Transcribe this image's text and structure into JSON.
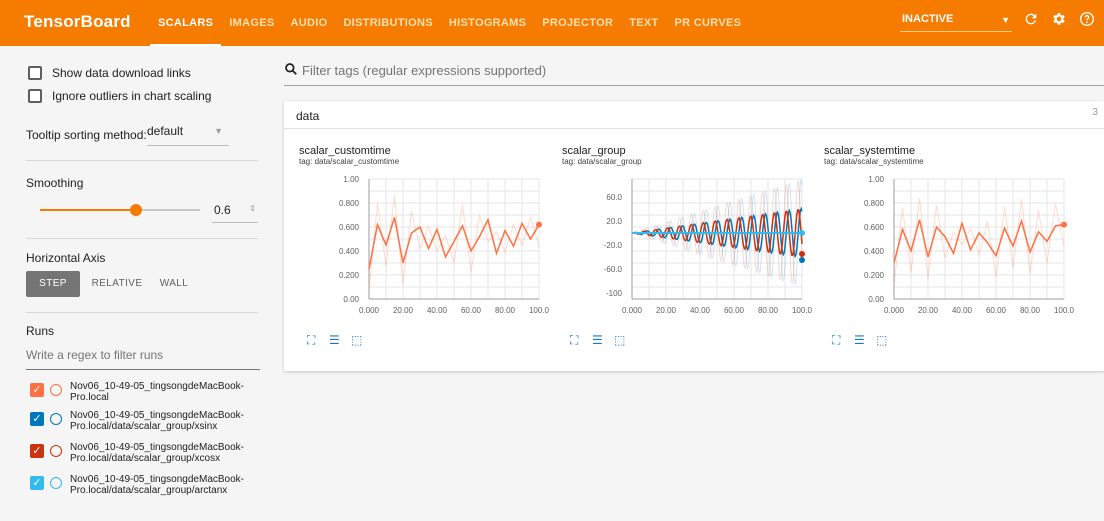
{
  "header": {
    "brand": "TensorBoard",
    "tabs": [
      {
        "label": "SCALARS",
        "active": true
      },
      {
        "label": "IMAGES",
        "active": false
      },
      {
        "label": "AUDIO",
        "active": false
      },
      {
        "label": "DISTRIBUTIONS",
        "active": false
      },
      {
        "label": "HISTOGRAMS",
        "active": false
      },
      {
        "label": "PROJECTOR",
        "active": false
      },
      {
        "label": "TEXT",
        "active": false
      },
      {
        "label": "PR CURVES",
        "active": false
      }
    ],
    "inactive_select": "INACTIVE",
    "icons": [
      "refresh-icon",
      "settings-icon",
      "help-icon"
    ]
  },
  "sidebar": {
    "show_download_links": "Show data download links",
    "ignore_outliers": "Ignore outliers in chart scaling",
    "tooltip_label": "Tooltip sorting method:",
    "tooltip_value": "default",
    "smoothing_title": "Smoothing",
    "smoothing_value": "0.6",
    "smoothing_fraction": 0.6,
    "horizontal_axis_title": "Horizontal Axis",
    "axis_options": [
      "STEP",
      "RELATIVE",
      "WALL"
    ],
    "runs_title": "Runs",
    "runs_filter_placeholder": "Write a regex to filter runs",
    "runs": [
      {
        "label": "Nov06_10-49-05_tingsongdeMacBook-Pro.local",
        "color": "#ff7043",
        "checked": true
      },
      {
        "label": "Nov06_10-49-05_tingsongdeMacBook-Pro.local/data/scalar_group/xsinx",
        "color": "#0077bb",
        "checked": true
      },
      {
        "label": "Nov06_10-49-05_tingsongdeMacBook-Pro.local/data/scalar_group/xcosx",
        "color": "#cc3311",
        "checked": true
      },
      {
        "label": "Nov06_10-49-05_tingsongdeMacBook-Pro.local/data/scalar_group/arctanx",
        "color": "#33bbee",
        "checked": true
      }
    ]
  },
  "main": {
    "filter_placeholder": "Filter tags (regular expressions supported)",
    "card_title": "data",
    "card_count": "3"
  },
  "charts": [
    {
      "title": "scalar_customtime",
      "tag": "tag: data/scalar_customtime",
      "yticks": [
        "1.00",
        "0.800",
        "0.600",
        "0.400",
        "0.200",
        "0.00"
      ],
      "xticks": [
        "0.000",
        "20.00",
        "40.00",
        "60.00",
        "80.00",
        "100.0"
      ]
    },
    {
      "title": "scalar_group",
      "tag": "tag: data/scalar_group",
      "yticks": [
        "60.0",
        "20.0",
        "-20.0",
        "-60.0",
        "-100"
      ],
      "xticks": [
        "0.000",
        "20.00",
        "40.00",
        "60.00",
        "80.00",
        "100.0"
      ]
    },
    {
      "title": "scalar_systemtime",
      "tag": "tag: data/scalar_systemtime",
      "yticks": [
        "1.00",
        "0.800",
        "0.600",
        "0.400",
        "0.200",
        "0.00"
      ],
      "xticks": [
        "0.000",
        "20.00",
        "40.00",
        "60.00",
        "80.00",
        "100.0"
      ]
    }
  ],
  "chart_data": [
    {
      "type": "line",
      "title": "scalar_customtime",
      "xlim": [
        0,
        100
      ],
      "ylim": [
        0,
        1
      ],
      "series": [
        {
          "color": "#ff7043",
          "x": [
            0,
            5,
            10,
            15,
            20,
            25,
            30,
            35,
            40,
            45,
            50,
            55,
            60,
            65,
            70,
            75,
            80,
            85,
            90,
            95,
            100
          ],
          "y": [
            0.25,
            0.62,
            0.45,
            0.68,
            0.3,
            0.55,
            0.6,
            0.42,
            0.58,
            0.35,
            0.48,
            0.61,
            0.4,
            0.52,
            0.66,
            0.38,
            0.57,
            0.44,
            0.63,
            0.5,
            0.62
          ]
        }
      ]
    },
    {
      "type": "line",
      "title": "scalar_group",
      "xlim": [
        0,
        100
      ],
      "ylim": [
        -110,
        90
      ],
      "series": [
        {
          "color": "#0077bb",
          "kind": "xsinx"
        },
        {
          "color": "#cc3311",
          "kind": "xcosx"
        },
        {
          "color": "#33bbee",
          "kind": "arctanx"
        }
      ]
    },
    {
      "type": "line",
      "title": "scalar_systemtime",
      "xlim": [
        0,
        100
      ],
      "ylim": [
        0,
        1
      ],
      "series": [
        {
          "color": "#ff7043",
          "x": [
            0,
            5,
            10,
            15,
            20,
            25,
            30,
            35,
            40,
            45,
            50,
            55,
            60,
            65,
            70,
            75,
            80,
            85,
            90,
            95,
            100
          ],
          "y": [
            0.3,
            0.58,
            0.4,
            0.66,
            0.35,
            0.6,
            0.52,
            0.38,
            0.63,
            0.41,
            0.55,
            0.47,
            0.36,
            0.59,
            0.44,
            0.65,
            0.39,
            0.56,
            0.48,
            0.61,
            0.62
          ]
        }
      ]
    }
  ]
}
